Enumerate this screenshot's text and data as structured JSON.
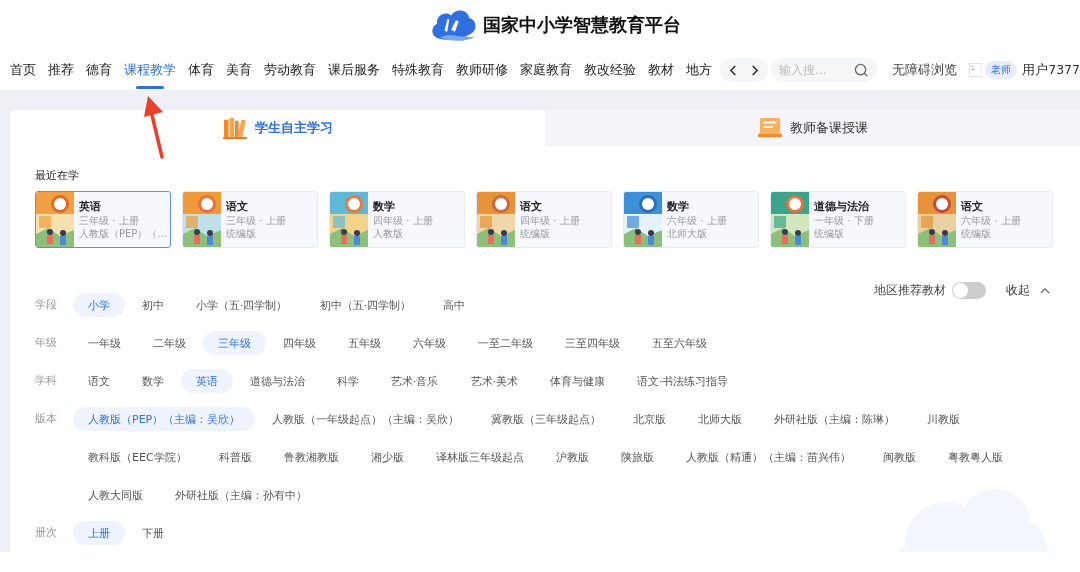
{
  "header": {
    "title": "国家中小学智慧教育平台"
  },
  "nav": {
    "items": [
      {
        "label": "首页",
        "selected": false
      },
      {
        "label": "推荐",
        "selected": false
      },
      {
        "label": "德育",
        "selected": false
      },
      {
        "label": "课程教学",
        "selected": true
      },
      {
        "label": "体育",
        "selected": false
      },
      {
        "label": "美育",
        "selected": false
      },
      {
        "label": "劳动教育",
        "selected": false
      },
      {
        "label": "课后服务",
        "selected": false
      },
      {
        "label": "特殊教育",
        "selected": false
      },
      {
        "label": "教师研修",
        "selected": false
      },
      {
        "label": "家庭教育",
        "selected": false
      },
      {
        "label": "教改经验",
        "selected": false
      },
      {
        "label": "教材",
        "selected": false
      },
      {
        "label": "地方",
        "selected": false
      }
    ],
    "search": {
      "placeholder": "输入搜..."
    },
    "accessibility_link": "无障碍浏览",
    "user": {
      "role_badge": "老师",
      "name": "用户7377"
    }
  },
  "tabs": [
    {
      "label": "学生自主学习",
      "selected": true
    },
    {
      "label": "教师备课授课",
      "selected": false
    }
  ],
  "recent": {
    "title": "最近在学",
    "books": [
      {
        "subject": "英语",
        "grade": "三年级 · 上册",
        "edition": "人教版（PEP）（...",
        "selected": true
      },
      {
        "subject": "语文",
        "grade": "三年级 · 上册",
        "edition": "统编版",
        "selected": false
      },
      {
        "subject": "数学",
        "grade": "四年级 · 上册",
        "edition": "人教版",
        "selected": false
      },
      {
        "subject": "语文",
        "grade": "四年级 · 上册",
        "edition": "统编版",
        "selected": false
      },
      {
        "subject": "数学",
        "grade": "六年级 · 上册",
        "edition": "北师大版",
        "selected": false
      },
      {
        "subject": "道德与法治",
        "grade": "一年级 · 下册",
        "edition": "统编版",
        "selected": false
      },
      {
        "subject": "语文",
        "grade": "六年级 · 上册",
        "edition": "统编版",
        "selected": false
      }
    ]
  },
  "filters": {
    "region_toggle": {
      "label": "地区推荐教材",
      "on": false
    },
    "collapse": "收起",
    "groups": [
      {
        "label": "学段",
        "options": [
          {
            "label": "小学",
            "selected": true
          },
          {
            "label": "初中",
            "selected": false
          },
          {
            "label": "小学（五·四学制）",
            "selected": false
          },
          {
            "label": "初中（五·四学制）",
            "selected": false
          },
          {
            "label": "高中",
            "selected": false
          }
        ]
      },
      {
        "label": "年级",
        "options": [
          {
            "label": "一年级",
            "selected": false
          },
          {
            "label": "二年级",
            "selected": false
          },
          {
            "label": "三年级",
            "selected": true
          },
          {
            "label": "四年级",
            "selected": false
          },
          {
            "label": "五年级",
            "selected": false
          },
          {
            "label": "六年级",
            "selected": false
          },
          {
            "label": "一至二年级",
            "selected": false
          },
          {
            "label": "三至四年级",
            "selected": false
          },
          {
            "label": "五至六年级",
            "selected": false
          }
        ]
      },
      {
        "label": "学科",
        "options": [
          {
            "label": "语文",
            "selected": false
          },
          {
            "label": "数学",
            "selected": false
          },
          {
            "label": "英语",
            "selected": true
          },
          {
            "label": "道德与法治",
            "selected": false
          },
          {
            "label": "科学",
            "selected": false
          },
          {
            "label": "艺术·音乐",
            "selected": false
          },
          {
            "label": "艺术·美术",
            "selected": false
          },
          {
            "label": "体育与健康",
            "selected": false
          },
          {
            "label": "语文·书法练习指导",
            "selected": false
          }
        ]
      },
      {
        "label": "版本",
        "options": [
          {
            "label": "人教版（PEP）（主编：吴欣）",
            "selected": true
          },
          {
            "label": "人教版（一年级起点）（主编：吴欣）",
            "selected": false
          },
          {
            "label": "冀教版（三年级起点）",
            "selected": false
          },
          {
            "label": "北京版",
            "selected": false
          },
          {
            "label": "北师大版",
            "selected": false
          },
          {
            "label": "外研社版（主编：陈琳）",
            "selected": false
          },
          {
            "label": "川教版",
            "selected": false
          },
          {
            "label": "教科版（EEC学院）",
            "selected": false
          },
          {
            "label": "科普版",
            "selected": false
          },
          {
            "label": "鲁教湘教版",
            "selected": false
          },
          {
            "label": "湘少版",
            "selected": false
          },
          {
            "label": "译林版三年级起点",
            "selected": false
          },
          {
            "label": "沪教版",
            "selected": false
          },
          {
            "label": "陕旅版",
            "selected": false
          },
          {
            "label": "人教版（精通）（主编：苗兴伟）",
            "selected": false
          },
          {
            "label": "闽教版",
            "selected": false
          },
          {
            "label": "粤教粤人版",
            "selected": false
          },
          {
            "label": "人教大同版",
            "selected": false
          },
          {
            "label": "外研社版（主编：孙有中）",
            "selected": false
          }
        ]
      },
      {
        "label": "册次",
        "options": [
          {
            "label": "上册",
            "selected": true
          },
          {
            "label": "下册",
            "selected": false
          }
        ]
      }
    ]
  }
}
